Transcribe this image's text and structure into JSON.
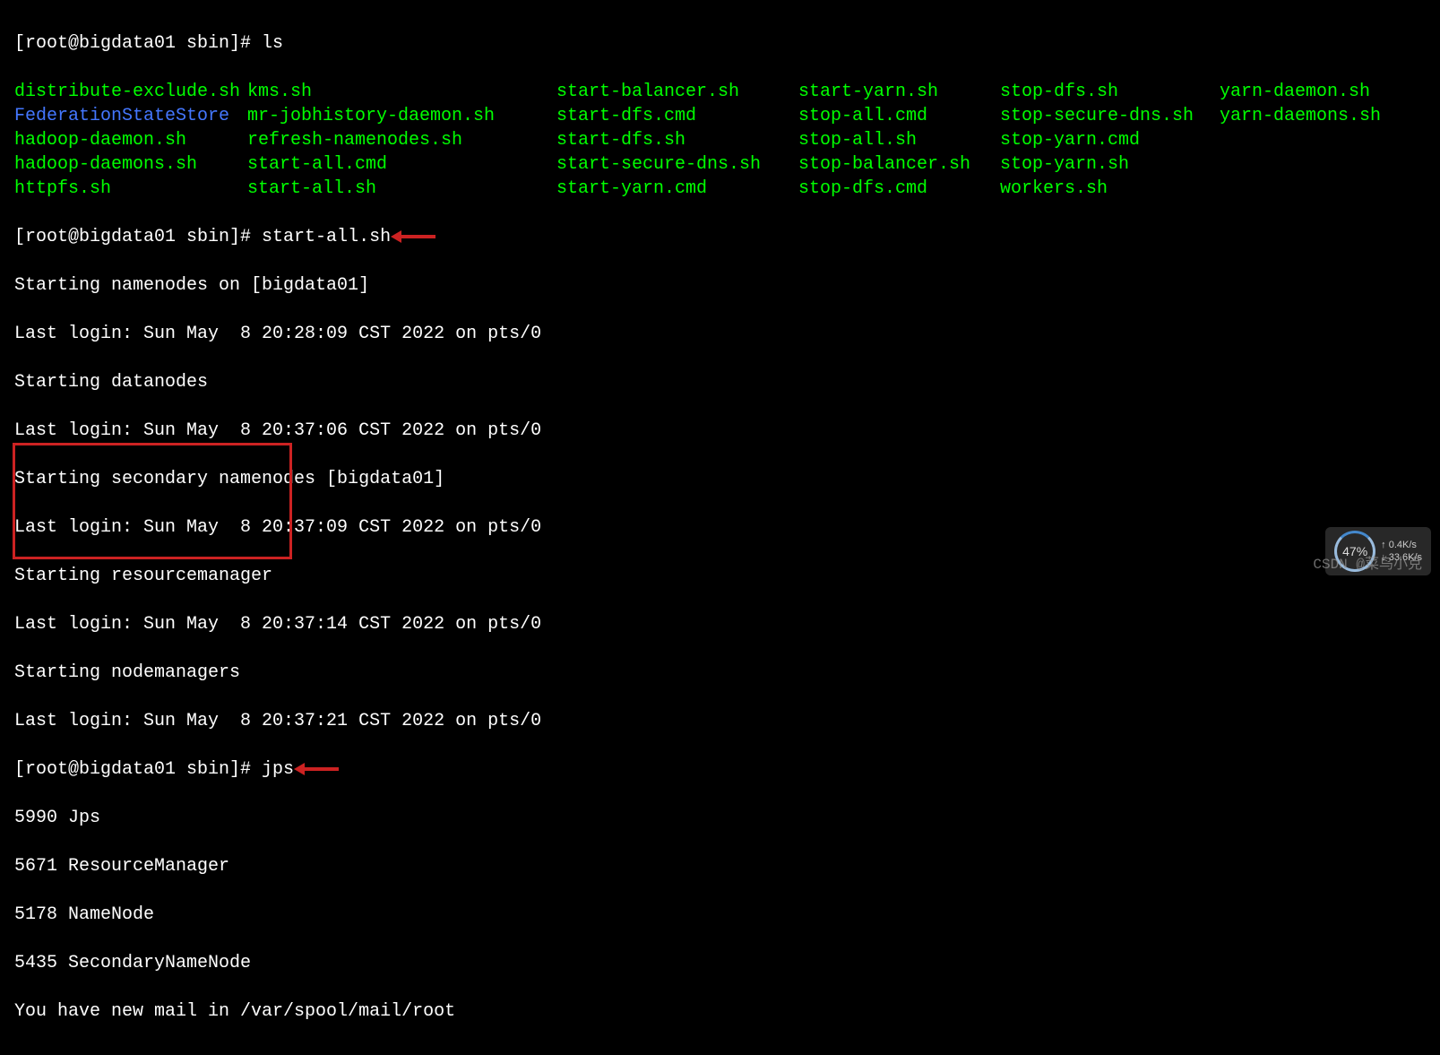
{
  "prompt1": "[root@bigdata01 sbin]# ",
  "cmd1": "ls",
  "ls": {
    "col1": [
      "distribute-exclude.sh",
      "FederationStateStore",
      "hadoop-daemon.sh",
      "hadoop-daemons.sh",
      "httpfs.sh"
    ],
    "col2": [
      "kms.sh",
      "mr-jobhistory-daemon.sh",
      "refresh-namenodes.sh",
      "start-all.cmd",
      "start-all.sh"
    ],
    "col3": [
      "start-balancer.sh",
      "start-dfs.cmd",
      "start-dfs.sh",
      "start-secure-dns.sh",
      "start-yarn.cmd"
    ],
    "col4": [
      "start-yarn.sh",
      "stop-all.cmd",
      "stop-all.sh",
      "stop-balancer.sh",
      "stop-dfs.cmd"
    ],
    "col5": [
      "stop-dfs.sh",
      "stop-secure-dns.sh",
      "stop-yarn.cmd",
      "stop-yarn.sh",
      "workers.sh"
    ],
    "col6": [
      "yarn-daemon.sh",
      "yarn-daemons.sh"
    ]
  },
  "prompt2": "[root@bigdata01 sbin]# ",
  "cmd2": "start-all.sh",
  "output": [
    "Starting namenodes on [bigdata01]",
    "Last login: Sun May  8 20:28:09 CST 2022 on pts/0",
    "Starting datanodes",
    "Last login: Sun May  8 20:37:06 CST 2022 on pts/0",
    "Starting secondary namenodes [bigdata01]",
    "Last login: Sun May  8 20:37:09 CST 2022 on pts/0",
    "Starting resourcemanager",
    "Last login: Sun May  8 20:37:14 CST 2022 on pts/0",
    "Starting nodemanagers",
    "Last login: Sun May  8 20:37:21 CST 2022 on pts/0"
  ],
  "prompt3": "[root@bigdata01 sbin]# ",
  "cmd3": "jps",
  "jps": [
    "5990 Jps",
    "5671 ResourceManager",
    "5178 NameNode",
    "5435 SecondaryNameNode"
  ],
  "mail": "You have new mail in /var/spool/mail/root",
  "watermark": "CSDN @菜鸟小克",
  "speed": {
    "percent": "47%",
    "up": "↑ 0.4K/s",
    "down": "↓ 33.6K/s"
  }
}
